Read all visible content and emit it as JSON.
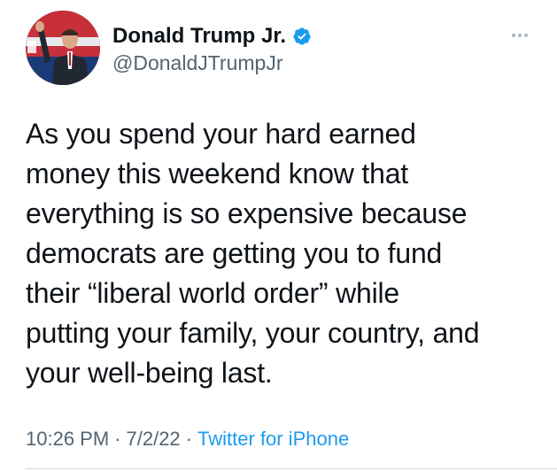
{
  "author": {
    "display_name": "Donald Trump Jr.",
    "handle": "@DonaldJTrumpJr",
    "verified": true,
    "avatar_icon": "profile-photo"
  },
  "tweet": {
    "lines": [
      "As you spend your hard earned",
      "money this weekend know that",
      "everything is so expensive because",
      "democrats are getting you to fund",
      "their “liberal world order” while",
      "putting your family, your country, and",
      "your well-being last."
    ]
  },
  "meta": {
    "time": "10:26 PM",
    "separator": "·",
    "date": "7/2/22",
    "source": "Twitter for iPhone"
  },
  "colors": {
    "text": "#0f1419",
    "secondary": "#536471",
    "link": "#1d9bf0",
    "verified": "#1d9bf0"
  },
  "icons": {
    "verified": "verified-badge-icon",
    "more": "more-options-icon"
  }
}
